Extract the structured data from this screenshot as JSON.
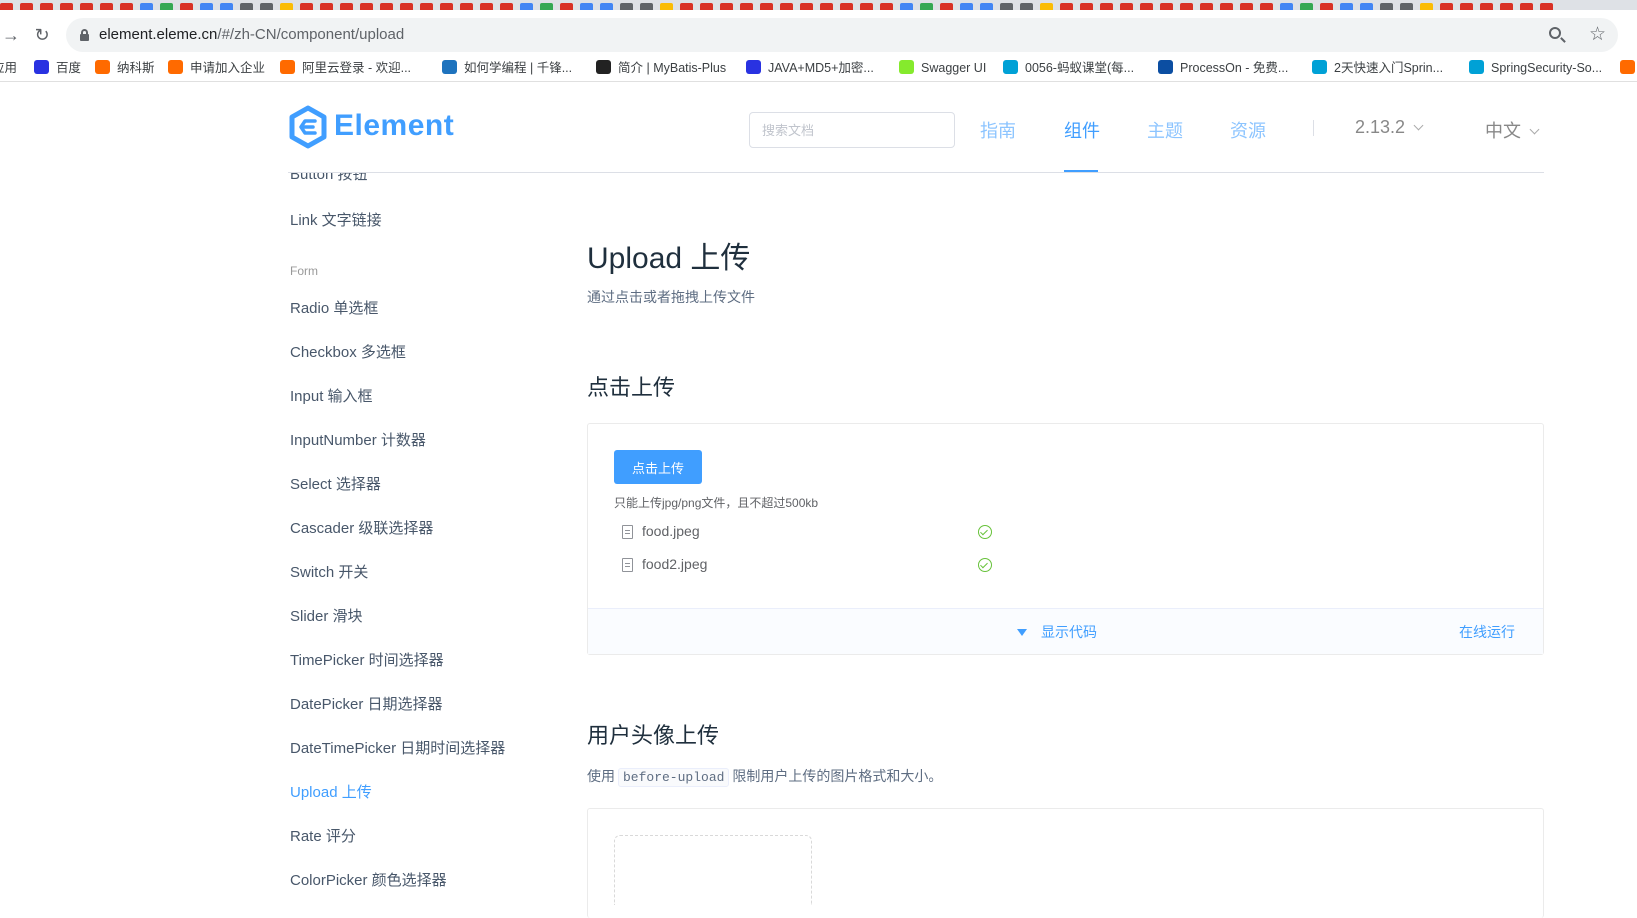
{
  "browser": {
    "url_host": "element.eleme.cn",
    "url_path": "/#/zh-CN/component/upload",
    "bookmarks": [
      {
        "label": "应用",
        "icon": "apps-icon",
        "color": "#4285f4"
      },
      {
        "label": "百度",
        "icon": "baidu-paw-icon",
        "color": "#2932e1"
      },
      {
        "label": "纳科斯",
        "icon": "bracket-icon",
        "color": "#ff6a00"
      },
      {
        "label": "申请加入企业",
        "icon": "bracket-icon",
        "color": "#ff6a00"
      },
      {
        "label": "阿里云登录 - 欢迎...",
        "icon": "bracket-icon",
        "color": "#ff6a00"
      },
      {
        "label": "如何学编程 | 千锋...",
        "icon": "swirl-icon",
        "color": "#1e73be"
      },
      {
        "label": "简介 | MyBatis-Plus",
        "icon": "bird-icon",
        "color": "#222222"
      },
      {
        "label": "JAVA+MD5+加密...",
        "icon": "baidu-paw-icon",
        "color": "#2932e1"
      },
      {
        "label": "Swagger UI",
        "icon": "swagger-icon",
        "color": "#85ea2d"
      },
      {
        "label": "0056-蚂蚁课堂(每...",
        "icon": "bilibili-icon",
        "color": "#00a1d6"
      },
      {
        "label": "ProcessOn - 免费...",
        "icon": "processon-icon",
        "color": "#0b4ea2"
      },
      {
        "label": "2天快速入门Sprin...",
        "icon": "bilibili-icon",
        "color": "#00a1d6"
      },
      {
        "label": "SpringSecurity-So...",
        "icon": "bilibili-icon",
        "color": "#00a1d6"
      }
    ]
  },
  "header": {
    "logo_text": "Element",
    "search_placeholder": "搜索文档",
    "nav": [
      "指南",
      "组件",
      "主题",
      "资源"
    ],
    "active_nav": "组件",
    "version": "2.13.2",
    "language": "中文",
    "brand_color": "#409eff"
  },
  "sidebar": {
    "items_top": [
      "Button 按钮",
      "Link 文字链接"
    ],
    "group_label": "Form",
    "items_form": [
      "Radio 单选框",
      "Checkbox 多选框",
      "Input 输入框",
      "InputNumber 计数器",
      "Select 选择器",
      "Cascader 级联选择器",
      "Switch 开关",
      "Slider 滑块",
      "TimePicker 时间选择器",
      "DatePicker 日期选择器",
      "DateTimePicker 日期时间选择器",
      "Upload 上传",
      "Rate 评分",
      "ColorPicker 颜色选择器"
    ],
    "active_item": "Upload 上传"
  },
  "main": {
    "title": "Upload 上传",
    "description": "通过点击或者拖拽上传文件",
    "section1": {
      "title": "点击上传",
      "button_label": "点击上传",
      "tip": "只能上传jpg/png文件，且不超过500kb",
      "files": [
        "food.jpeg",
        "food2.jpeg"
      ],
      "show_code": "显示代码",
      "run_online": "在线运行"
    },
    "section2": {
      "title": "用户头像上传",
      "desc_prefix": "使用",
      "desc_code": "before-upload",
      "desc_suffix": "限制用户上传的图片格式和大小。"
    }
  }
}
